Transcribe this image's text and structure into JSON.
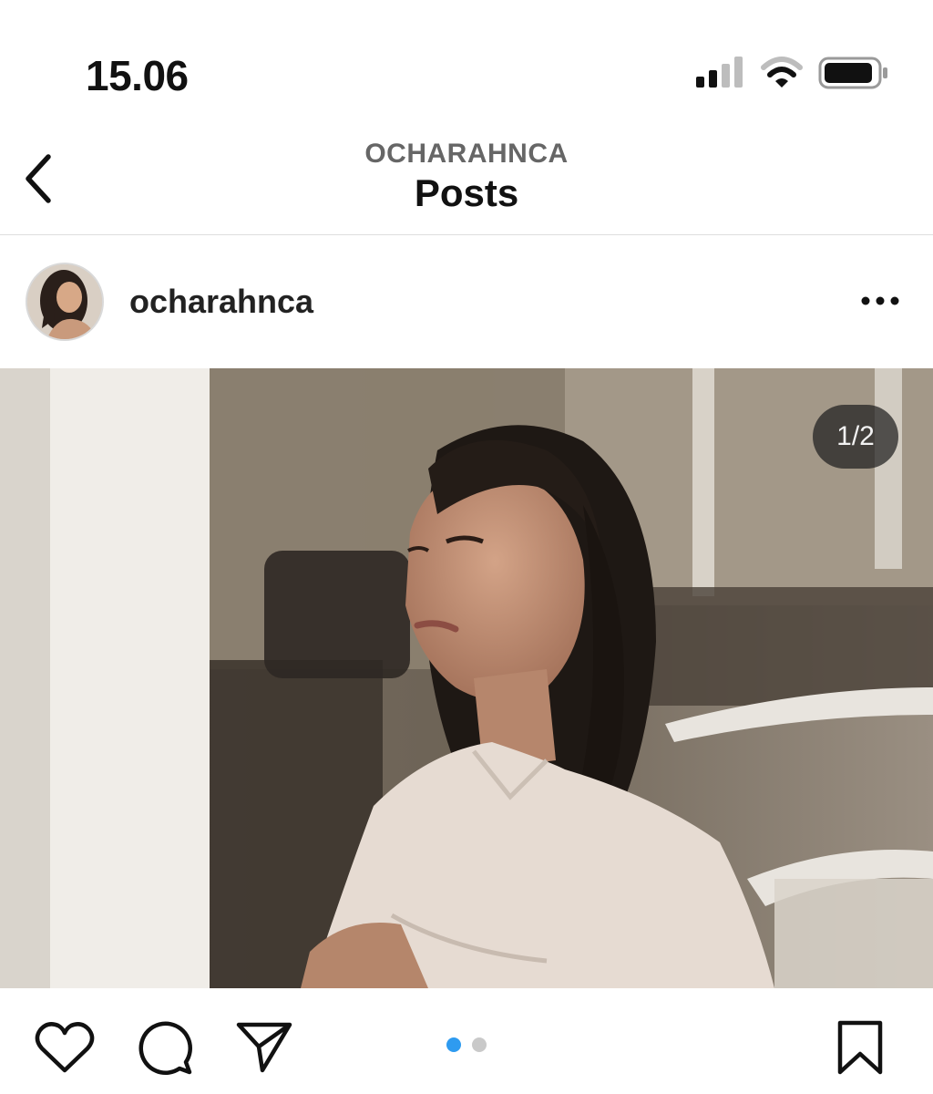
{
  "status_bar": {
    "time": "15.06",
    "icons": [
      "signal-icon",
      "wifi-icon",
      "battery-icon"
    ]
  },
  "header": {
    "back_icon": "chevron-left-icon",
    "username": "OCHARAHNCA",
    "title": "Posts"
  },
  "post": {
    "username": "ocharahnca",
    "more_icon": "more-horizontal-icon",
    "photo_counter": "1/2",
    "carousel": {
      "current": 1,
      "total": 2
    },
    "actions": [
      "heart-icon",
      "comment-icon",
      "share-icon",
      "bookmark-icon"
    ]
  },
  "colors": {
    "carousel_active": "#2e9bf0",
    "carousel_inactive": "#c9c9c9",
    "divider": "#dedede"
  }
}
